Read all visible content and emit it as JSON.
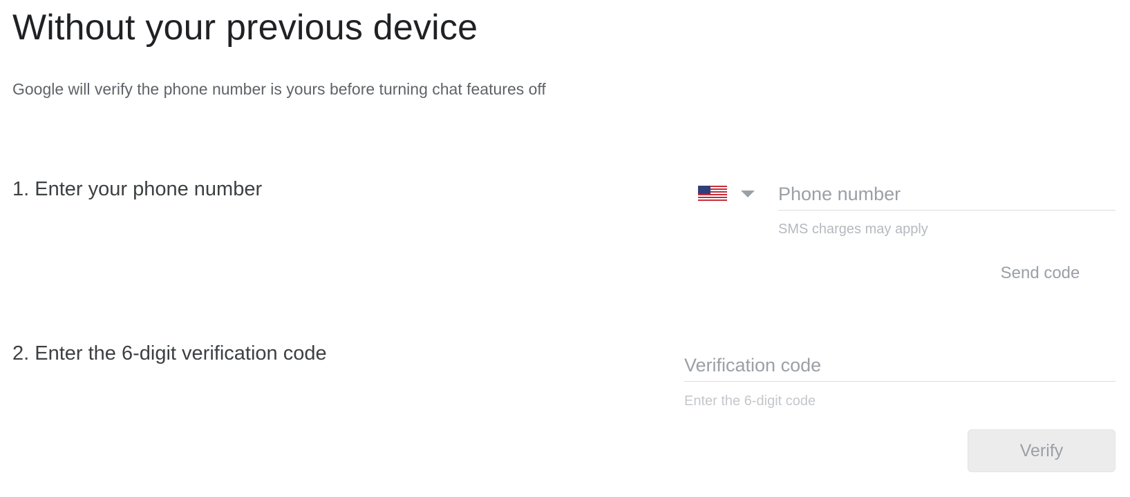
{
  "page": {
    "title": "Without your previous device",
    "subtitle": "Google will verify the phone number is yours before turning chat features off"
  },
  "step1": {
    "label": "1. Enter your phone number",
    "country": {
      "selected": "us-flag-icon",
      "caret_icon": "caret-down-icon"
    },
    "phone": {
      "placeholder": "Phone number",
      "value": "",
      "helper": "SMS charges may apply"
    },
    "send_label": "Send code"
  },
  "step2": {
    "label": "2. Enter the 6-digit verification code",
    "code": {
      "placeholder": "Verification code",
      "value": "",
      "helper": "Enter the 6-digit code"
    },
    "verify_label": "Verify"
  },
  "colors": {
    "title_text": "#202124",
    "secondary_text": "#5f6368",
    "disabled_text": "#9aa0a6",
    "field_underline": "#dadce0",
    "verify_button_bg": "#ececec"
  }
}
